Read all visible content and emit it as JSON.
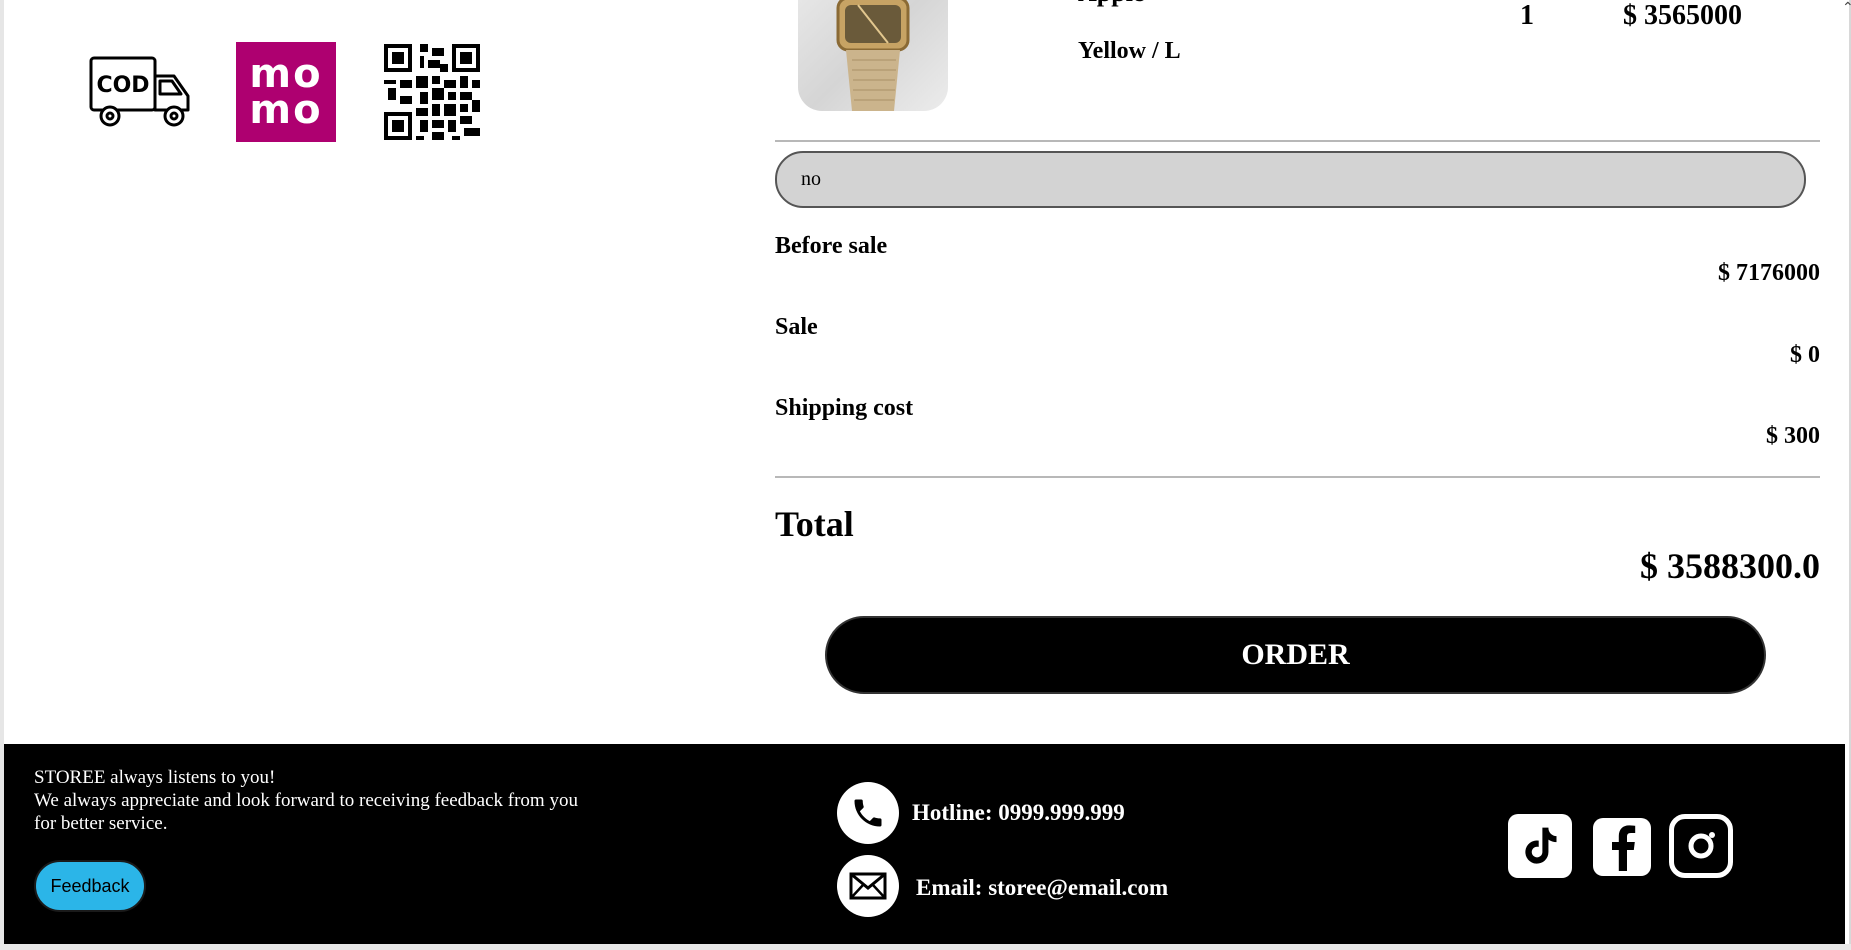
{
  "payment_methods": {
    "cod_label": "COD",
    "momo_line1": "mo",
    "momo_line2": "mo",
    "icons": [
      "cod-truck-icon",
      "momo-icon",
      "qr-code-icon"
    ],
    "momo_color": "#ae0070"
  },
  "cart_item": {
    "name": "Apple",
    "variant": "Yellow / L",
    "quantity": "1",
    "price": "$ 3565000"
  },
  "note": {
    "value": "no"
  },
  "summary": {
    "before_sale_label": "Before sale",
    "before_sale_value": "$ 7176000",
    "sale_label": "Sale",
    "sale_value": "$ 0",
    "shipping_label": "Shipping cost",
    "shipping_value": "$ 300",
    "total_label": "Total",
    "total_value": "$ 3588300.0"
  },
  "order_button": {
    "label": "ORDER"
  },
  "footer": {
    "line1": "STOREE always listens to you!",
    "line2": "We always appreciate and look forward to receiving feedback from you",
    "line3": "for better service.",
    "feedback_label": "Feedback",
    "hotline": "Hotline: 0999.999.999",
    "email": "Email: storee@email.com",
    "feedback_color": "#2bb5e8",
    "social_icons": [
      "tiktok-icon",
      "facebook-icon",
      "instagram-icon"
    ]
  }
}
